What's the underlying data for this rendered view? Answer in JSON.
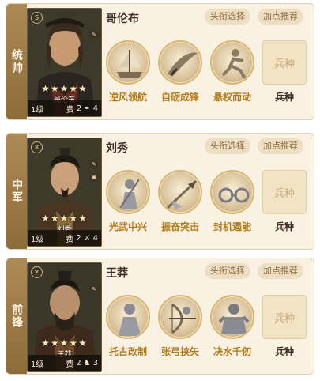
{
  "pills": {
    "title_select": "头衔选择",
    "points_recommend": "加点推荐"
  },
  "troop": {
    "box_label": "兵种",
    "caption": "兵种"
  },
  "stars": "★★★★★",
  "generals": [
    {
      "position": "统帅",
      "name": "哥伦布",
      "portrait_name": "哥伦布",
      "level": "1级",
      "cost_label": "费",
      "cost": "2",
      "unit_count": "4",
      "unit_icon": "feather-icon",
      "skills": [
        "逆风领航",
        "自砺成锋",
        "悬权而动"
      ]
    },
    {
      "position": "中军",
      "name": "刘秀",
      "portrait_name": "刘秀",
      "level": "1级",
      "cost_label": "费",
      "cost": "2",
      "unit_count": "4",
      "unit_icon": "halberd-icon",
      "skills": [
        "光武中兴",
        "振奋突击",
        "封机遏能"
      ]
    },
    {
      "position": "前锋",
      "name": "王莽",
      "portrait_name": "王莽",
      "level": "1级",
      "cost_label": "费",
      "cost": "2",
      "unit_count": "3",
      "unit_icon": "horse-icon",
      "skills": [
        "托古改制",
        "张弓挟矢",
        "决水千仞"
      ]
    }
  ]
}
